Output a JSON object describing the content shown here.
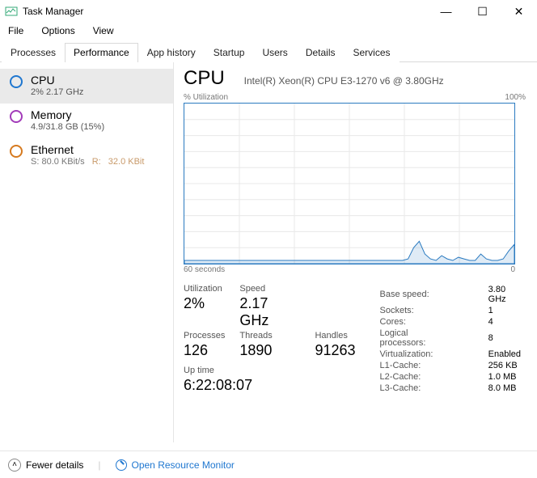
{
  "window": {
    "title": "Task Manager"
  },
  "menu": {
    "file": "File",
    "options": "Options",
    "view": "View"
  },
  "tabs": {
    "processes": "Processes",
    "performance": "Performance",
    "app_history": "App history",
    "startup": "Startup",
    "users": "Users",
    "details": "Details",
    "services": "Services"
  },
  "sidebar": {
    "cpu": {
      "name": "CPU",
      "sub": "2%  2.17 GHz"
    },
    "memory": {
      "name": "Memory",
      "sub": "4.9/31.8 GB (15%)"
    },
    "ethernet": {
      "name": "Ethernet",
      "send_label": "S:",
      "send": "80.0 KBit/s",
      "recv_label": "R:",
      "recv": "32.0 KBit"
    }
  },
  "main": {
    "title": "CPU",
    "model": "Intel(R) Xeon(R) CPU E3-1270 v6 @ 3.80GHz",
    "chart_top_left": "% Utilization",
    "chart_top_right": "100%",
    "chart_bot_left": "60 seconds",
    "chart_bot_right": "0"
  },
  "stats": {
    "utilization_lbl": "Utilization",
    "utilization": "2%",
    "speed_lbl": "Speed",
    "speed": "2.17 GHz",
    "processes_lbl": "Processes",
    "processes": "126",
    "threads_lbl": "Threads",
    "threads": "1890",
    "handles_lbl": "Handles",
    "handles": "91263",
    "uptime_lbl": "Up time",
    "uptime": "6:22:08:07"
  },
  "specs": {
    "base_speed_lbl": "Base speed:",
    "base_speed": "3.80 GHz",
    "sockets_lbl": "Sockets:",
    "sockets": "1",
    "cores_lbl": "Cores:",
    "cores": "4",
    "lprocs_lbl": "Logical processors:",
    "lprocs": "8",
    "virt_lbl": "Virtualization:",
    "virt": "Enabled",
    "l1_lbl": "L1-Cache:",
    "l1": "256 KB",
    "l2_lbl": "L2-Cache:",
    "l2": "1.0 MB",
    "l3_lbl": "L3-Cache:",
    "l3": "8.0 MB"
  },
  "footer": {
    "fewer": "Fewer details",
    "orm": "Open Resource Monitor"
  },
  "chart_data": {
    "type": "line",
    "title": "% Utilization",
    "xlabel": "60 seconds → 0",
    "ylabel": "% Utilization",
    "ylim": [
      0,
      100
    ],
    "xlim_seconds": [
      60,
      0
    ],
    "values_percent": [
      2,
      2,
      2,
      2,
      2,
      2,
      2,
      2,
      2,
      2,
      2,
      2,
      2,
      2,
      2,
      2,
      2,
      2,
      2,
      2,
      2,
      2,
      2,
      2,
      2,
      2,
      2,
      2,
      2,
      2,
      2,
      2,
      2,
      2,
      2,
      2,
      2,
      2,
      2,
      2,
      3,
      10,
      14,
      6,
      3,
      2,
      5,
      3,
      2,
      4,
      3,
      2,
      2,
      6,
      3,
      2,
      2,
      3,
      8,
      12
    ]
  }
}
